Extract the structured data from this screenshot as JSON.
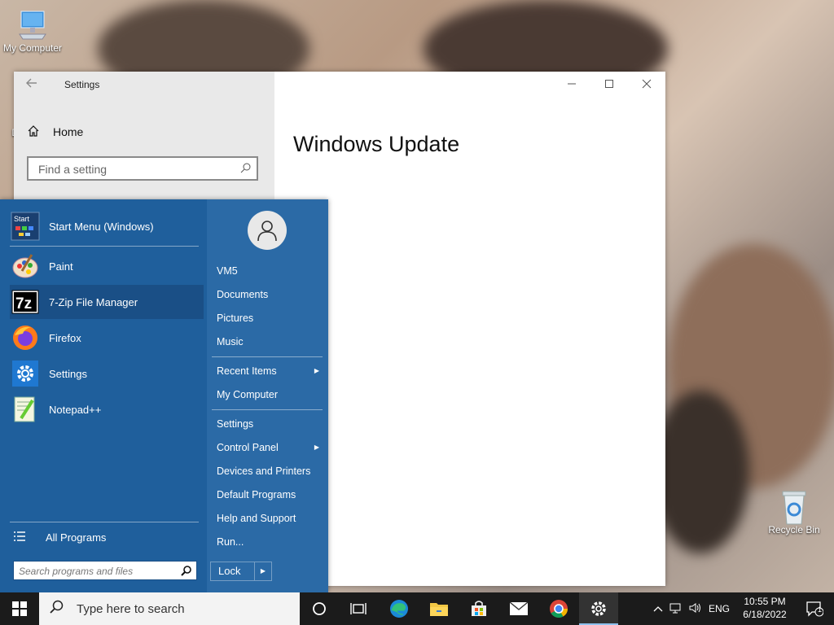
{
  "desktop": {
    "icons": [
      {
        "label": "My Computer",
        "icon": "computer-icon"
      },
      {
        "label": "Da",
        "icon": "partial-icon"
      },
      {
        "label": "Recycle Bin",
        "icon": "recycle-bin-icon"
      }
    ]
  },
  "settings_window": {
    "title": "Settings",
    "home_label": "Home",
    "search_placeholder": "Find a setting",
    "page_title": "Windows Update",
    "controls": {
      "minimize": "—",
      "maximize": "☐",
      "close": "✕"
    }
  },
  "start_menu": {
    "pinned": [
      {
        "label": "Start Menu (Windows)",
        "icon": "start-menu-app-icon"
      },
      {
        "label": "Paint",
        "icon": "paint-icon"
      },
      {
        "label": "7-Zip File Manager",
        "icon": "7zip-icon"
      },
      {
        "label": "Firefox",
        "icon": "firefox-icon"
      },
      {
        "label": "Settings",
        "icon": "settings-gear-icon"
      },
      {
        "label": "Notepad++",
        "icon": "notepadpp-icon"
      }
    ],
    "all_programs": "All Programs",
    "search_placeholder": "Search programs and files",
    "right": {
      "user": "VM5",
      "documents": "Documents",
      "pictures": "Pictures",
      "music": "Music",
      "recent_items": "Recent Items",
      "my_computer": "My Computer",
      "settings": "Settings",
      "control_panel": "Control Panel",
      "devices_printers": "Devices and Printers",
      "default_programs": "Default Programs",
      "help_support": "Help and Support",
      "run": "Run..."
    },
    "lock_label": "Lock"
  },
  "taskbar": {
    "search_placeholder": "Type here to search",
    "apps": [
      "cortana-icon",
      "task-view-icon",
      "edge-icon",
      "file-explorer-icon",
      "store-icon",
      "mail-icon",
      "chrome-icon",
      "settings-icon"
    ],
    "tray": {
      "language": "ENG",
      "time": "10:55 PM",
      "date": "6/18/2022",
      "notifications": "1"
    }
  },
  "colors": {
    "start_menu": "#2b6aa6",
    "start_left": "#1f5f9c",
    "taskbar": "#1b1b1b"
  }
}
